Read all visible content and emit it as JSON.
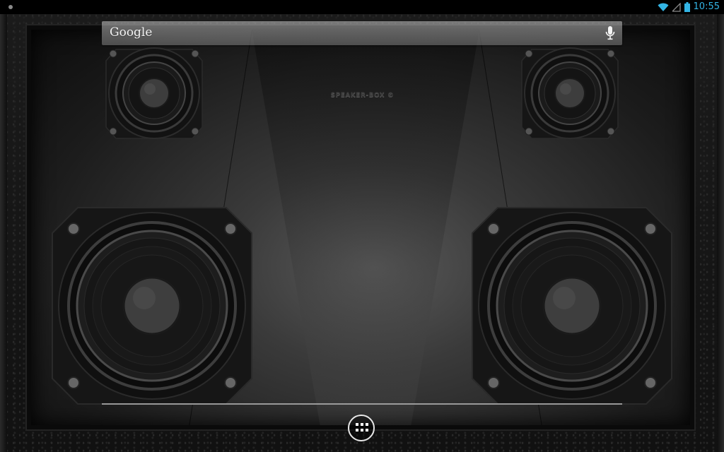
{
  "status_bar": {
    "time": "10:55",
    "icons": [
      "wifi-icon",
      "signal-icon",
      "battery-icon"
    ],
    "accent_color": "#33b5e5"
  },
  "search": {
    "label": "Google",
    "icon": "mic-icon"
  },
  "wallpaper": {
    "brand_text": "SPEAKER-BOX ©"
  },
  "dock": {
    "apps_icon": "all-apps-icon"
  }
}
